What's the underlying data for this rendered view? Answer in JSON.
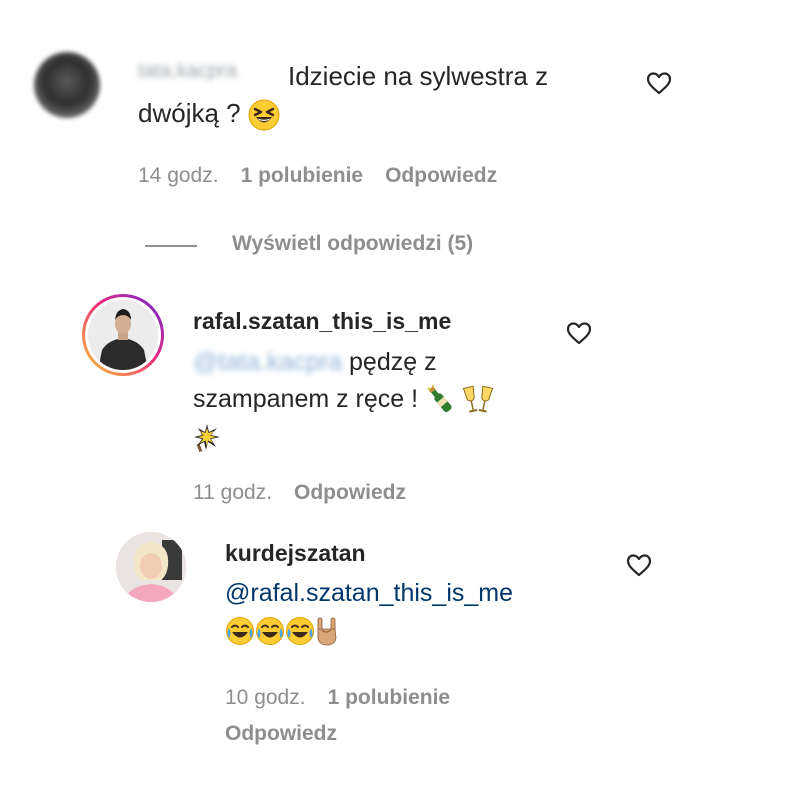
{
  "comments": [
    {
      "username": "tata.kacpra",
      "text_line1": "Idziecie na sylwestra z",
      "text_line2": "dwójką ?",
      "emoji": "laughing-face",
      "time": "14 godz.",
      "likes": "1 polubienie",
      "reply_label": "Odpowiedz",
      "view_replies": "Wyświetl odpowiedzi (5)"
    },
    {
      "username": "rafal.szatan_this_is_me",
      "mention": "@tata.kacpra",
      "text_part1": "pędzę z",
      "text_part2": "szampanem z ręce !",
      "emojis": [
        "bottle-with-popping-cork",
        "clinking-glasses",
        "sparkler"
      ],
      "time": "11 godz.",
      "reply_label": "Odpowiedz"
    },
    {
      "username": "kurdejszatan",
      "mention": "@rafal.szatan_this_is_me",
      "emojis": [
        "tears-of-joy",
        "tears-of-joy",
        "tears-of-joy",
        "sign-of-the-horns"
      ],
      "time": "10 godz.",
      "likes": "1 polubienie",
      "reply_label": "Odpowiedz"
    }
  ],
  "colors": {
    "text": "#262626",
    "secondary": "#8e8e8e",
    "mention": "#00376b",
    "story_ring_start": "#f9ce34",
    "story_ring_end": "#6228d7"
  },
  "icons": {
    "like": "heart-outline-icon"
  }
}
